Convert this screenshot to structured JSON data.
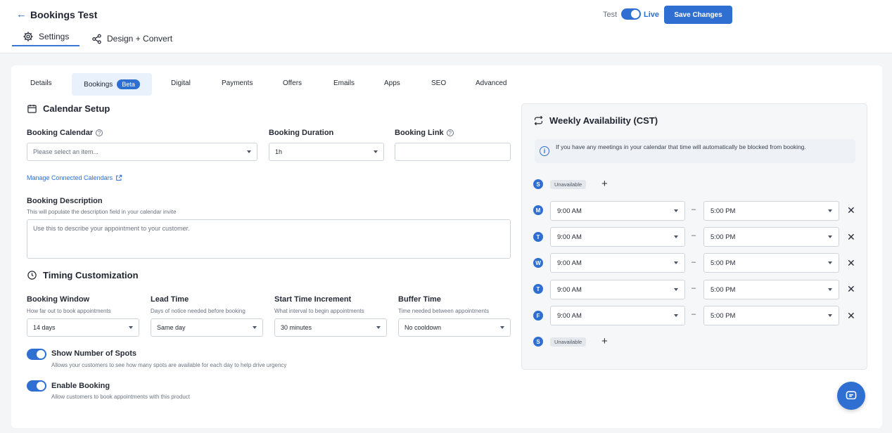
{
  "header": {
    "back_icon": "arrow-left-icon",
    "title": "Bookings Test",
    "tabs": [
      {
        "label": "Settings",
        "icon": "gear-icon"
      },
      {
        "label": "Design + Convert",
        "icon": "share-nodes-icon"
      }
    ],
    "mode_test": "Test",
    "mode_live": "Live",
    "live_enabled": true,
    "save_label": "Save Changes"
  },
  "subtabs": {
    "items": [
      "Details",
      "Bookings",
      "Digital",
      "Payments",
      "Offers",
      "Emails",
      "Apps",
      "SEO",
      "Advanced"
    ],
    "active": "Bookings",
    "badge": "Beta"
  },
  "calendar_setup": {
    "title": "Calendar Setup",
    "booking_calendar": {
      "label": "Booking Calendar",
      "placeholder": "Please select an item..."
    },
    "booking_duration": {
      "label": "Booking Duration",
      "value": "1h"
    },
    "booking_link": {
      "label": "Booking Link",
      "value": ""
    },
    "manage_link": "Manage Connected Calendars",
    "description": {
      "label": "Booking Description",
      "hint": "This will populate the description field in your calendar invite",
      "placeholder": "Use this to describe your appointment to your customer."
    }
  },
  "timing": {
    "title": "Timing Customization",
    "fields": [
      {
        "label": "Booking Window",
        "hint": "How far out to book appointments",
        "value": "14 days"
      },
      {
        "label": "Lead Time",
        "hint": "Days of notice needed before booking",
        "value": "Same day"
      },
      {
        "label": "Start Time Increment",
        "hint": "What interval to begin appointments",
        "value": "30 minutes"
      },
      {
        "label": "Buffer Time",
        "hint": "Time needed between appointments",
        "value": "No cooldown"
      }
    ]
  },
  "options": [
    {
      "label": "Show Number of Spots",
      "desc": "Allows your customers to see how many spots are available for each day to help drive urgency",
      "enabled": true
    },
    {
      "label": "Enable Booking",
      "desc": "Allow customers to book appointments with this product",
      "enabled": true
    }
  ],
  "availability": {
    "title": "Weekly Availability (CST)",
    "info": "If you have any meetings in your calendar that time will automatically be blocked from booking.",
    "unavailable_label": "Unavailable",
    "days": [
      {
        "letter": "S",
        "available": false
      },
      {
        "letter": "M",
        "available": true,
        "start": "9:00 AM",
        "end": "5:00 PM"
      },
      {
        "letter": "T",
        "available": true,
        "start": "9:00 AM",
        "end": "5:00 PM"
      },
      {
        "letter": "W",
        "available": true,
        "start": "9:00 AM",
        "end": "5:00 PM"
      },
      {
        "letter": "T",
        "available": true,
        "start": "9:00 AM",
        "end": "5:00 PM"
      },
      {
        "letter": "F",
        "available": true,
        "start": "9:00 AM",
        "end": "5:00 PM"
      },
      {
        "letter": "S",
        "available": false
      }
    ],
    "separator": "–"
  },
  "colors": {
    "accent": "#2f6fd1",
    "active_tab_bg": "#e9f1fc"
  }
}
